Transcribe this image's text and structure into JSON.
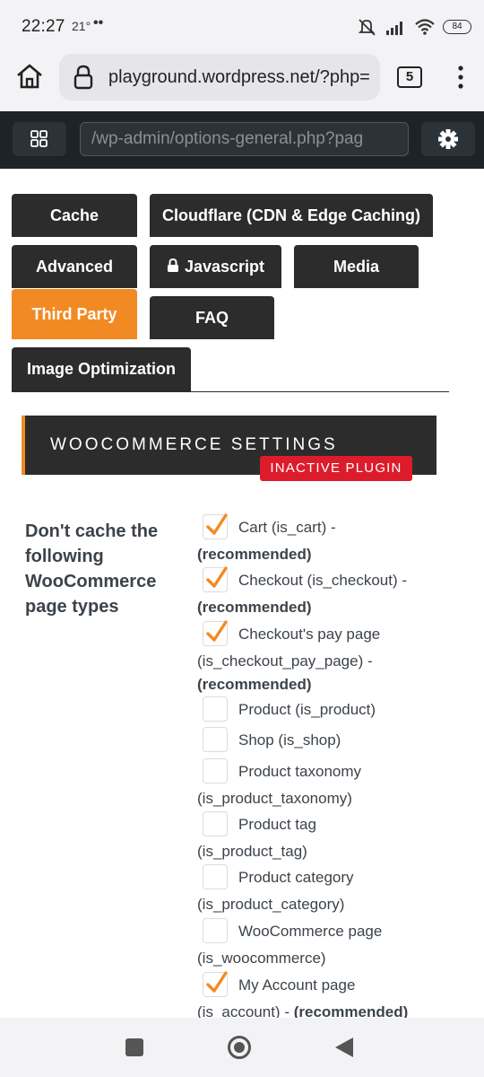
{
  "status_bar": {
    "time": "22:27",
    "temperature": "21°",
    "dots": "••",
    "battery": "84"
  },
  "browser": {
    "url": "playground.wordpress.net/?php=",
    "tab_count": "5"
  },
  "wp_admin_bar": {
    "url": "/wp-admin/options-general.php?pag"
  },
  "tabs": {
    "cache": "Cache",
    "cloudflare": "Cloudflare (CDN & Edge Caching)",
    "advanced": "Advanced",
    "javascript": "Javascript",
    "media": "Media",
    "third_party": "Third Party",
    "faq": "FAQ",
    "image_optimization": "Image Optimization"
  },
  "section": {
    "title": "WOOCOMMERCE SETTINGS",
    "badge": "INACTIVE PLUGIN"
  },
  "form": {
    "label": "Don't cache the following WooCommerce page types",
    "options": [
      {
        "first": "Cart (is_cart) -",
        "rest": "",
        "recommended": "(recommended)",
        "checked": true
      },
      {
        "first": "Checkout (is_checkout) -",
        "rest": "",
        "recommended": "(recommended)",
        "checked": true
      },
      {
        "first": "Checkout's pay page",
        "rest": "(is_checkout_pay_page) -",
        "recommended": "(recommended)",
        "checked": true
      },
      {
        "first": "Product (is_product)",
        "rest": "",
        "recommended": "",
        "checked": false
      },
      {
        "first": "Shop (is_shop)",
        "rest": "",
        "recommended": "",
        "checked": false
      },
      {
        "first": "Product taxonomy",
        "rest": "(is_product_taxonomy)",
        "recommended": "",
        "checked": false
      },
      {
        "first": "Product tag",
        "rest": "(is_product_tag)",
        "recommended": "",
        "checked": false
      },
      {
        "first": "Product category",
        "rest": "(is_product_category)",
        "recommended": "",
        "checked": false
      },
      {
        "first": "WooCommerce page",
        "rest": "(is_woocommerce)",
        "recommended": "",
        "checked": false
      },
      {
        "first": "My Account page",
        "rest": "(is_account) -",
        "recommended": "(recommended)",
        "checked": true
      }
    ]
  },
  "colors": {
    "accent": "#f28a23",
    "dark": "#2c2c2c",
    "badge": "#dd1c2b"
  }
}
